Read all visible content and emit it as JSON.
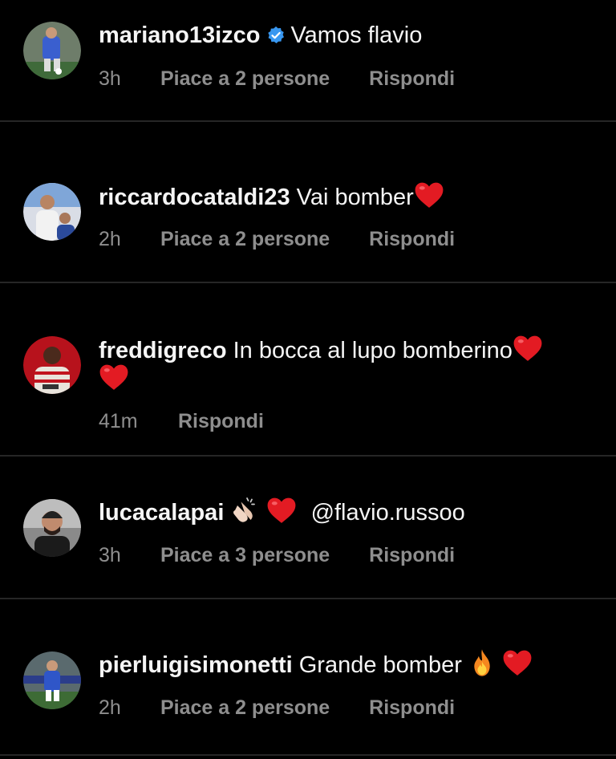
{
  "comments": [
    {
      "username": "mariano13izco",
      "verified": true,
      "text": "Vamos flavio",
      "time": "3h",
      "likes": "Piace a 2 persone",
      "reply": "Rispondi"
    },
    {
      "username": "riccardocataldi23",
      "verified": false,
      "text": "Vai bomber",
      "emoji_after": "heart-icon",
      "time": "2h",
      "likes": "Piace a 2 persone",
      "reply": "Rispondi"
    },
    {
      "username": "freddigreco",
      "verified": false,
      "text": "In bocca al lupo bomberino",
      "emoji_after": "heart-icon",
      "emoji_line2": "heart-icon",
      "time": "41m",
      "reply": "Rispondi"
    },
    {
      "username": "lucacalapai",
      "verified": false,
      "emoji": [
        "clapping-hands-icon",
        "heart-icon"
      ],
      "text": "@flavio.russoo",
      "time": "3h",
      "likes": "Piace a 3 persone",
      "reply": "Rispondi"
    },
    {
      "username": "pierluigisimonetti",
      "verified": false,
      "text": "Grande bomber",
      "emoji_after": [
        "fire-icon",
        "heart-icon"
      ],
      "time": "2h",
      "likes": "Piace a 2 persone",
      "reply": "Rispondi"
    }
  ],
  "colors": {
    "background": "#000000",
    "username": "#f5f5f5",
    "meta": "#8e8e8e",
    "verified": "#3897f0",
    "heart": "#e31b23",
    "divider": "#262626"
  }
}
